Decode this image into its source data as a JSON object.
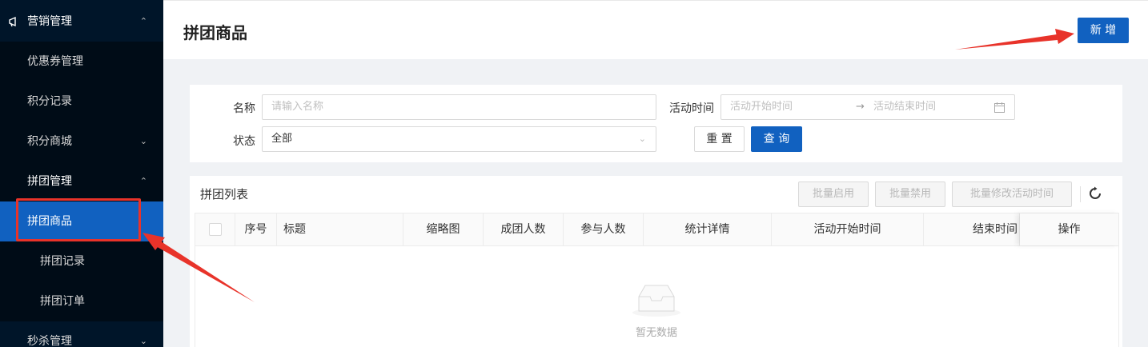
{
  "sidebar": {
    "marketing": "营销管理",
    "coupon": "优惠券管理",
    "points_record": "积分记录",
    "points_mall": "积分商城",
    "group_buy": "拼团管理",
    "group_goods": "拼团商品",
    "group_record": "拼团记录",
    "group_order": "拼团订单",
    "flash_sale": "秒杀管理"
  },
  "header": {
    "title": "拼团商品",
    "add_button": "新 增"
  },
  "filter": {
    "name_label": "名称",
    "name_placeholder": "请输入名称",
    "time_label": "活动时间",
    "start_placeholder": "活动开始时间",
    "end_placeholder": "活动结束时间",
    "status_label": "状态",
    "status_value": "全部",
    "reset": "重 置",
    "search": "查 询"
  },
  "list": {
    "title": "拼团列表",
    "batch_enable": "批量启用",
    "batch_disable": "批量禁用",
    "batch_edit_time": "批量修改活动时间",
    "columns": [
      "序号",
      "标题",
      "缩略图",
      "成团人数",
      "参与人数",
      "统计详情",
      "活动开始时间",
      "结束时间",
      "操作"
    ],
    "empty_text": "暂无数据"
  },
  "colors": {
    "sidebar_bg": "#001529",
    "primary": "#1161c0",
    "annotation": "#e8332a"
  }
}
